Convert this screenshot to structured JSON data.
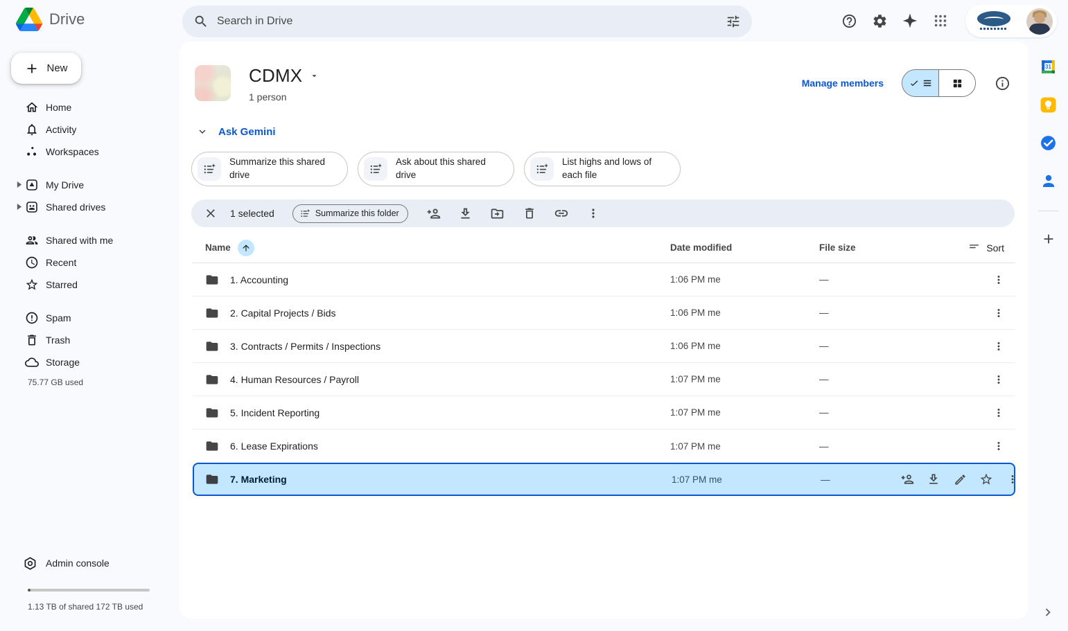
{
  "colors": {
    "accent_blue": "#0b57d0",
    "selection_bg": "#c2e7ff",
    "selected_row_border": "#0b57d0",
    "toolbar_bg": "#e9eef6",
    "page_bg": "#f8fafd",
    "keep_yellow": "#ffba00",
    "tasks_blue": "#1a73e8"
  },
  "icons": {
    "search": "magnifier",
    "filters": "tune-sliders",
    "help": "question-circle",
    "settings": "gear",
    "gemini": "sparkle",
    "apps": "grid-9-dots",
    "summarize": "list-sparkle",
    "view_list": "check-list",
    "view_grid": "grid-squares",
    "info": "i-circle",
    "folder": "folder-filled"
  },
  "topbar": {
    "app_name": "Drive",
    "search_placeholder": "Search in Drive"
  },
  "sidebar": {
    "new_button": "New",
    "items": [
      {
        "label": "Home"
      },
      {
        "label": "Activity"
      },
      {
        "label": "Workspaces"
      },
      {
        "label": "My Drive"
      },
      {
        "label": "Shared drives"
      },
      {
        "label": "Shared with me"
      },
      {
        "label": "Recent"
      },
      {
        "label": "Starred"
      },
      {
        "label": "Spam"
      },
      {
        "label": "Trash"
      },
      {
        "label": "Storage"
      }
    ],
    "storage_used": "75.77 GB used",
    "admin_console": "Admin console",
    "storage_summary": "1.13 TB of shared 172 TB used"
  },
  "header": {
    "title": "CDMX",
    "members": "1 person",
    "manage_members": "Manage members"
  },
  "gemini": {
    "toggle_label": "Ask Gemini",
    "chips": [
      "Summarize this shared drive",
      "Ask about this shared drive",
      "List highs and lows of each file"
    ]
  },
  "selection_bar": {
    "selected_count": "1 selected",
    "summarize_button": "Summarize this folder"
  },
  "table": {
    "columns": {
      "name": "Name",
      "modified": "Date modified",
      "size": "File size"
    },
    "sort_label": "Sort",
    "rows": [
      {
        "name": "1. Accounting",
        "modified": "1:06 PM me",
        "size": "—"
      },
      {
        "name": "2. Capital Projects / Bids",
        "modified": "1:06 PM me",
        "size": "—"
      },
      {
        "name": "3. Contracts / Permits / Inspections",
        "modified": "1:06 PM me",
        "size": "—"
      },
      {
        "name": "4. Human Resources / Payroll",
        "modified": "1:07 PM me",
        "size": "—"
      },
      {
        "name": "5. Incident Reporting",
        "modified": "1:07 PM me",
        "size": "—"
      },
      {
        "name": "6. Lease Expirations",
        "modified": "1:07 PM me",
        "size": "—"
      },
      {
        "name": "7. Marketing",
        "modified": "1:07 PM me",
        "size": "—",
        "selected": true
      }
    ]
  }
}
